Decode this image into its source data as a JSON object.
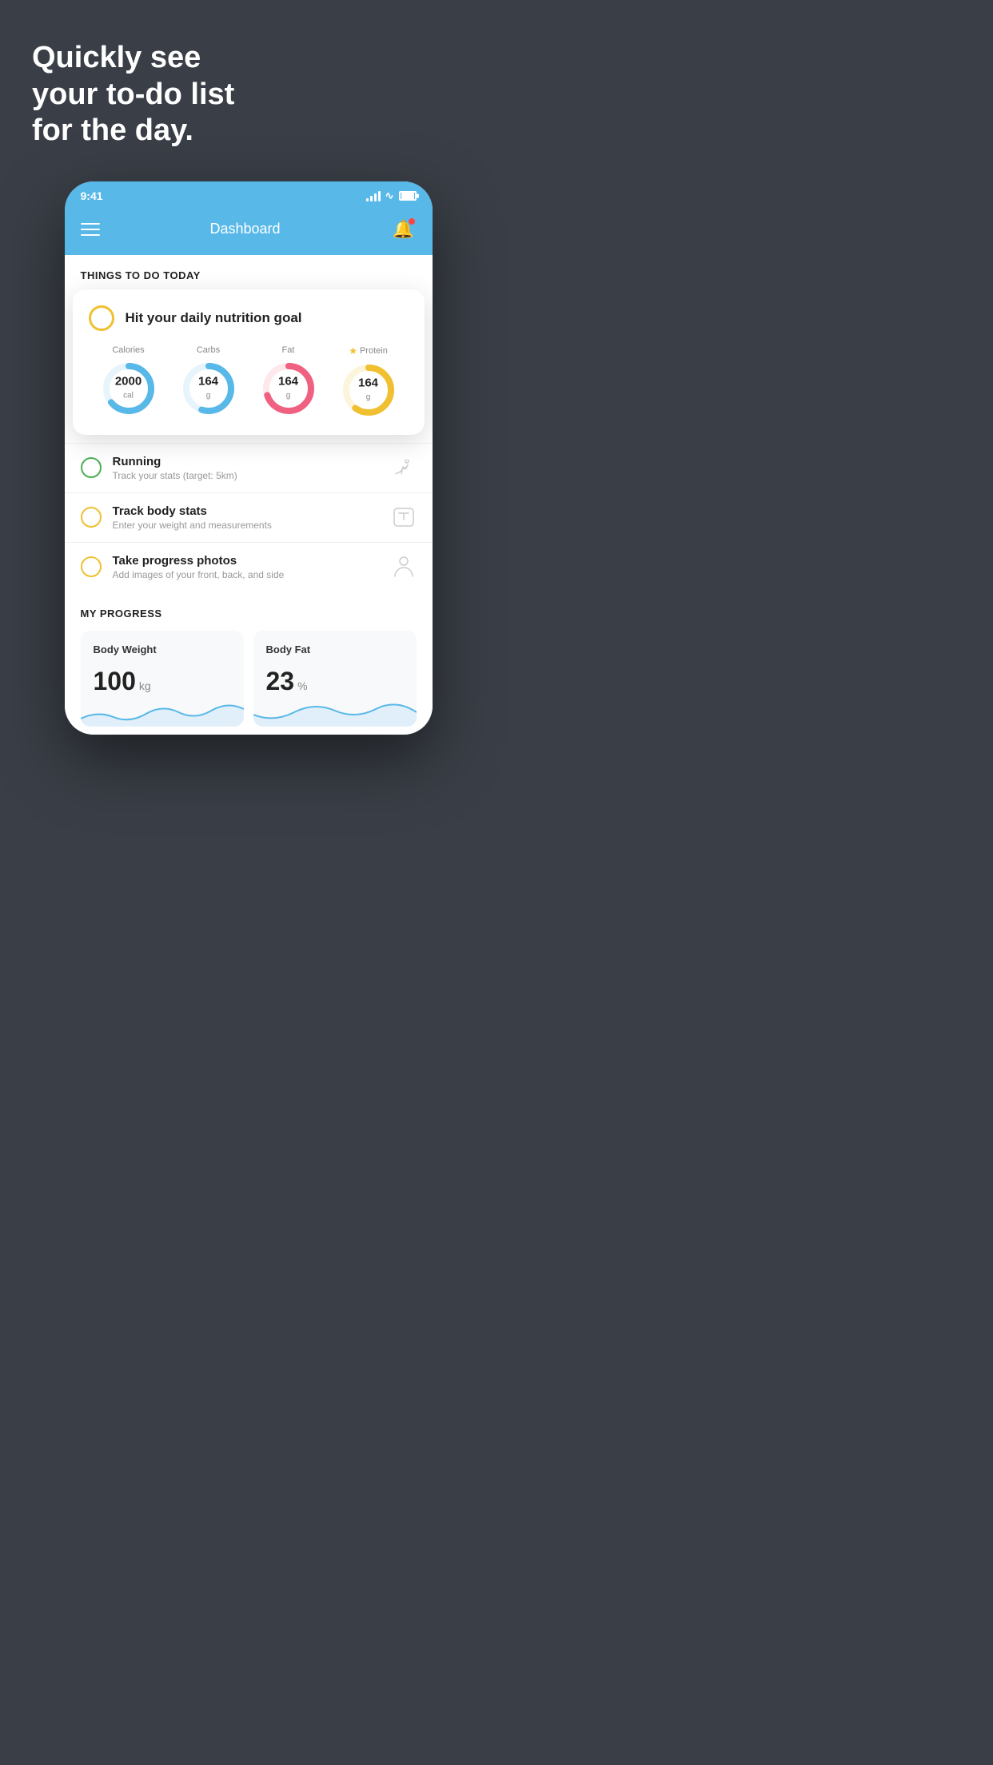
{
  "background_color": "#3a3f47",
  "headline": {
    "line1": "Quickly see",
    "line2": "your to-do list",
    "line3": "for the day."
  },
  "status_bar": {
    "time": "9:41"
  },
  "header": {
    "title": "Dashboard"
  },
  "things_section": {
    "label": "THINGS TO DO TODAY"
  },
  "nutrition_card": {
    "checkbox_color": "#f0c030",
    "title": "Hit your daily nutrition goal",
    "items": [
      {
        "label": "Calories",
        "value": "2000",
        "unit": "cal",
        "color": "#58b8e8",
        "track_color": "#e8f4fc",
        "percent": 65,
        "starred": false
      },
      {
        "label": "Carbs",
        "value": "164",
        "unit": "g",
        "color": "#58b8e8",
        "track_color": "#e8f4fc",
        "percent": 55,
        "starred": false
      },
      {
        "label": "Fat",
        "value": "164",
        "unit": "g",
        "color": "#f06080",
        "track_color": "#fde8ec",
        "percent": 70,
        "starred": false
      },
      {
        "label": "Protein",
        "value": "164",
        "unit": "g",
        "color": "#f0c030",
        "track_color": "#fdf4dc",
        "percent": 60,
        "starred": true
      }
    ]
  },
  "todo_items": [
    {
      "id": "running",
      "title": "Running",
      "subtitle": "Track your stats (target: 5km)",
      "circle_color": "green",
      "icon": "shoe"
    },
    {
      "id": "body-stats",
      "title": "Track body stats",
      "subtitle": "Enter your weight and measurements",
      "circle_color": "yellow",
      "icon": "scale"
    },
    {
      "id": "progress-photos",
      "title": "Take progress photos",
      "subtitle": "Add images of your front, back, and side",
      "circle_color": "yellow",
      "icon": "person"
    }
  ],
  "progress_section": {
    "label": "MY PROGRESS",
    "cards": [
      {
        "title": "Body Weight",
        "value": "100",
        "unit": "kg"
      },
      {
        "title": "Body Fat",
        "value": "23",
        "unit": "%"
      }
    ]
  }
}
